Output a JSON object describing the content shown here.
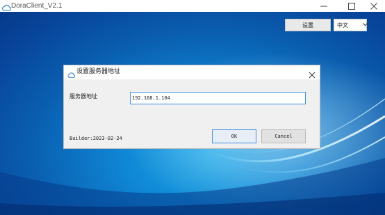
{
  "app": {
    "title": "DoraClient_V2.1",
    "icon": "cloud-icon"
  },
  "window_controls": {
    "minimize_icon": "minimize-icon",
    "maximize_icon": "maximize-icon",
    "close_icon": "close-icon"
  },
  "toolbar": {
    "settings_label": "设置",
    "language_value": "中文"
  },
  "dialog": {
    "title": "设置服务器地址",
    "icon": "cloud-icon",
    "field_label": "服务器地址",
    "field_value": "192.168.1.104",
    "builder_text": "Builder:2023-02-24",
    "ok_label": "OK",
    "cancel_label": "Cancel"
  },
  "colors": {
    "accent": "#3c8ee0",
    "background_blue": "#0f86d4"
  }
}
